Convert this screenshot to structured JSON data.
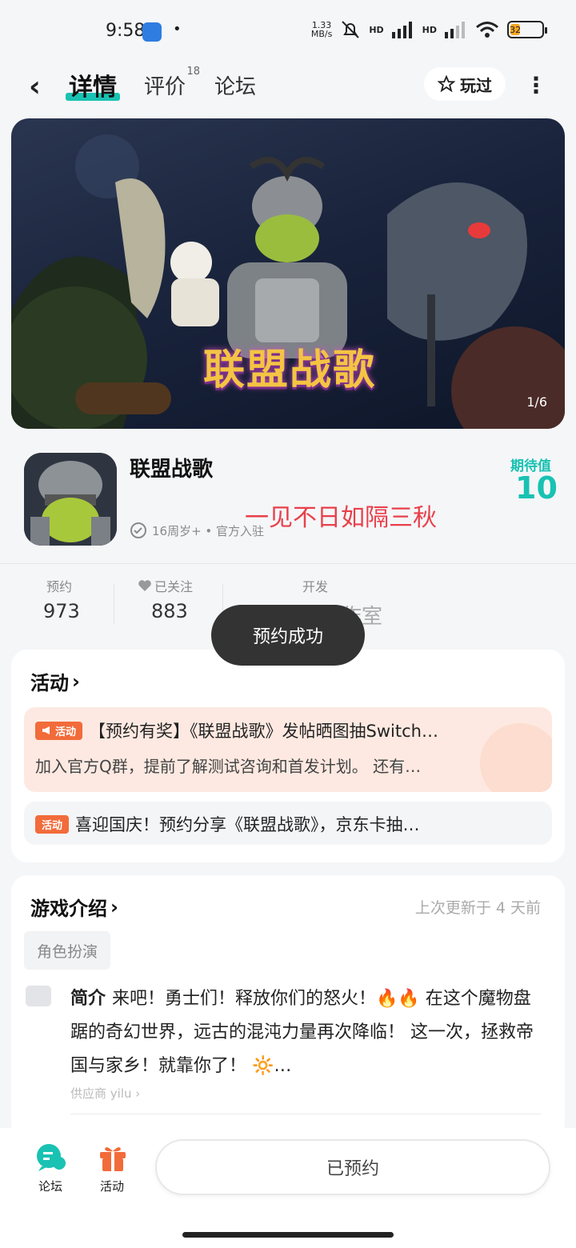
{
  "status_bar": {
    "time": "9:58",
    "dot": "•",
    "net_speed": "1.33",
    "net_unit": "MB/s",
    "hd1": "HD",
    "hd2": "HD",
    "battery": "32",
    "icons": [
      "browser-icon",
      "mute-bell-icon",
      "signal-icon",
      "signal-icon",
      "wifi-icon",
      "battery-icon"
    ]
  },
  "header": {
    "back_icon": "‹",
    "tabs": [
      {
        "label": "详情",
        "active": true
      },
      {
        "label": "评价",
        "count": "18"
      },
      {
        "label": "论坛"
      }
    ],
    "played_label": "玩过",
    "more_icon": "⋮"
  },
  "banner": {
    "logo_text": "联盟战歌",
    "counter": "1/6"
  },
  "game": {
    "name": "联盟战歌",
    "meta": "16周岁+ • 官方入驻",
    "slogan": "一见不日如隔三秋",
    "expect_label": "期待值",
    "expect_value": "10"
  },
  "stats": {
    "reserve_label": "预约",
    "reserve_value": "973",
    "follow_label": "已关注",
    "follow_value": "883",
    "dev_label": "开发",
    "dev_value": "星辰动漫工作室"
  },
  "toast": "预约成功",
  "activities": {
    "title": "活动",
    "chevron": "›",
    "items": [
      {
        "badge": "活动",
        "title": "【预约有奖】《联盟战歌》发帖晒图抽Switch…",
        "sub": "加入官方Q群，提前了解测试咨询和首发计划。 还有…"
      },
      {
        "badge": "活动",
        "title": "喜迎国庆！预约分享《联盟战歌》，京东卡抽…"
      }
    ]
  },
  "intro": {
    "title": "游戏介绍",
    "updated": "上次更新于 4 天前",
    "tag": "角色扮演",
    "label": "简介",
    "text": "来吧！勇士们！释放你们的怒火！🔥🔥 在这个魔物盘踞的奇幻世界，远古的混沌力量再次降临！ 这一次，拯救帝国与家乡！就靠你了！ 🔆…",
    "supplier": "供应商 yilu ›"
  },
  "bottom": {
    "forum_label": "论坛",
    "activity_label": "活动",
    "reserved_label": "已预约"
  },
  "colors": {
    "accent": "#19c2b2",
    "activity_orange": "#f26b3a",
    "slogan_red": "#e8404a"
  }
}
